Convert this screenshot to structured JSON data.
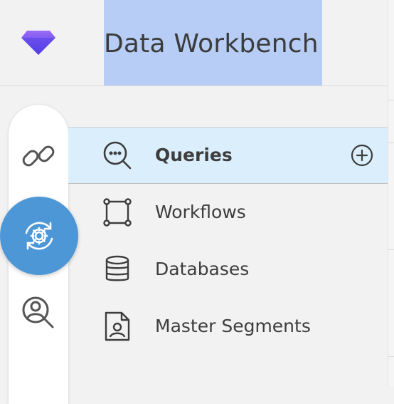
{
  "header": {
    "title": "Data Workbench",
    "logo_icon": "gem-icon"
  },
  "rail": {
    "items": [
      {
        "icon": "link-icon",
        "active": false
      },
      {
        "icon": "gear-sync-icon",
        "active": true
      },
      {
        "icon": "user-search-icon",
        "active": false
      }
    ]
  },
  "menu": {
    "items": [
      {
        "label": "Queries",
        "icon": "query-search-icon",
        "active": true,
        "action_icon": "add-circle-icon"
      },
      {
        "label": "Workflows",
        "icon": "workflow-nodes-icon",
        "active": false
      },
      {
        "label": "Databases",
        "icon": "database-icon",
        "active": false
      },
      {
        "label": "Master Segments",
        "icon": "profile-document-icon",
        "active": false
      }
    ]
  },
  "colors": {
    "background": "#f2f2f2",
    "title_selection": "#b7cdf6",
    "active_rail": "#4e97d6",
    "active_row": "#dbeefb",
    "logo_gradient_start": "#8b5cf6",
    "logo_gradient_end": "#5b3ee8"
  }
}
